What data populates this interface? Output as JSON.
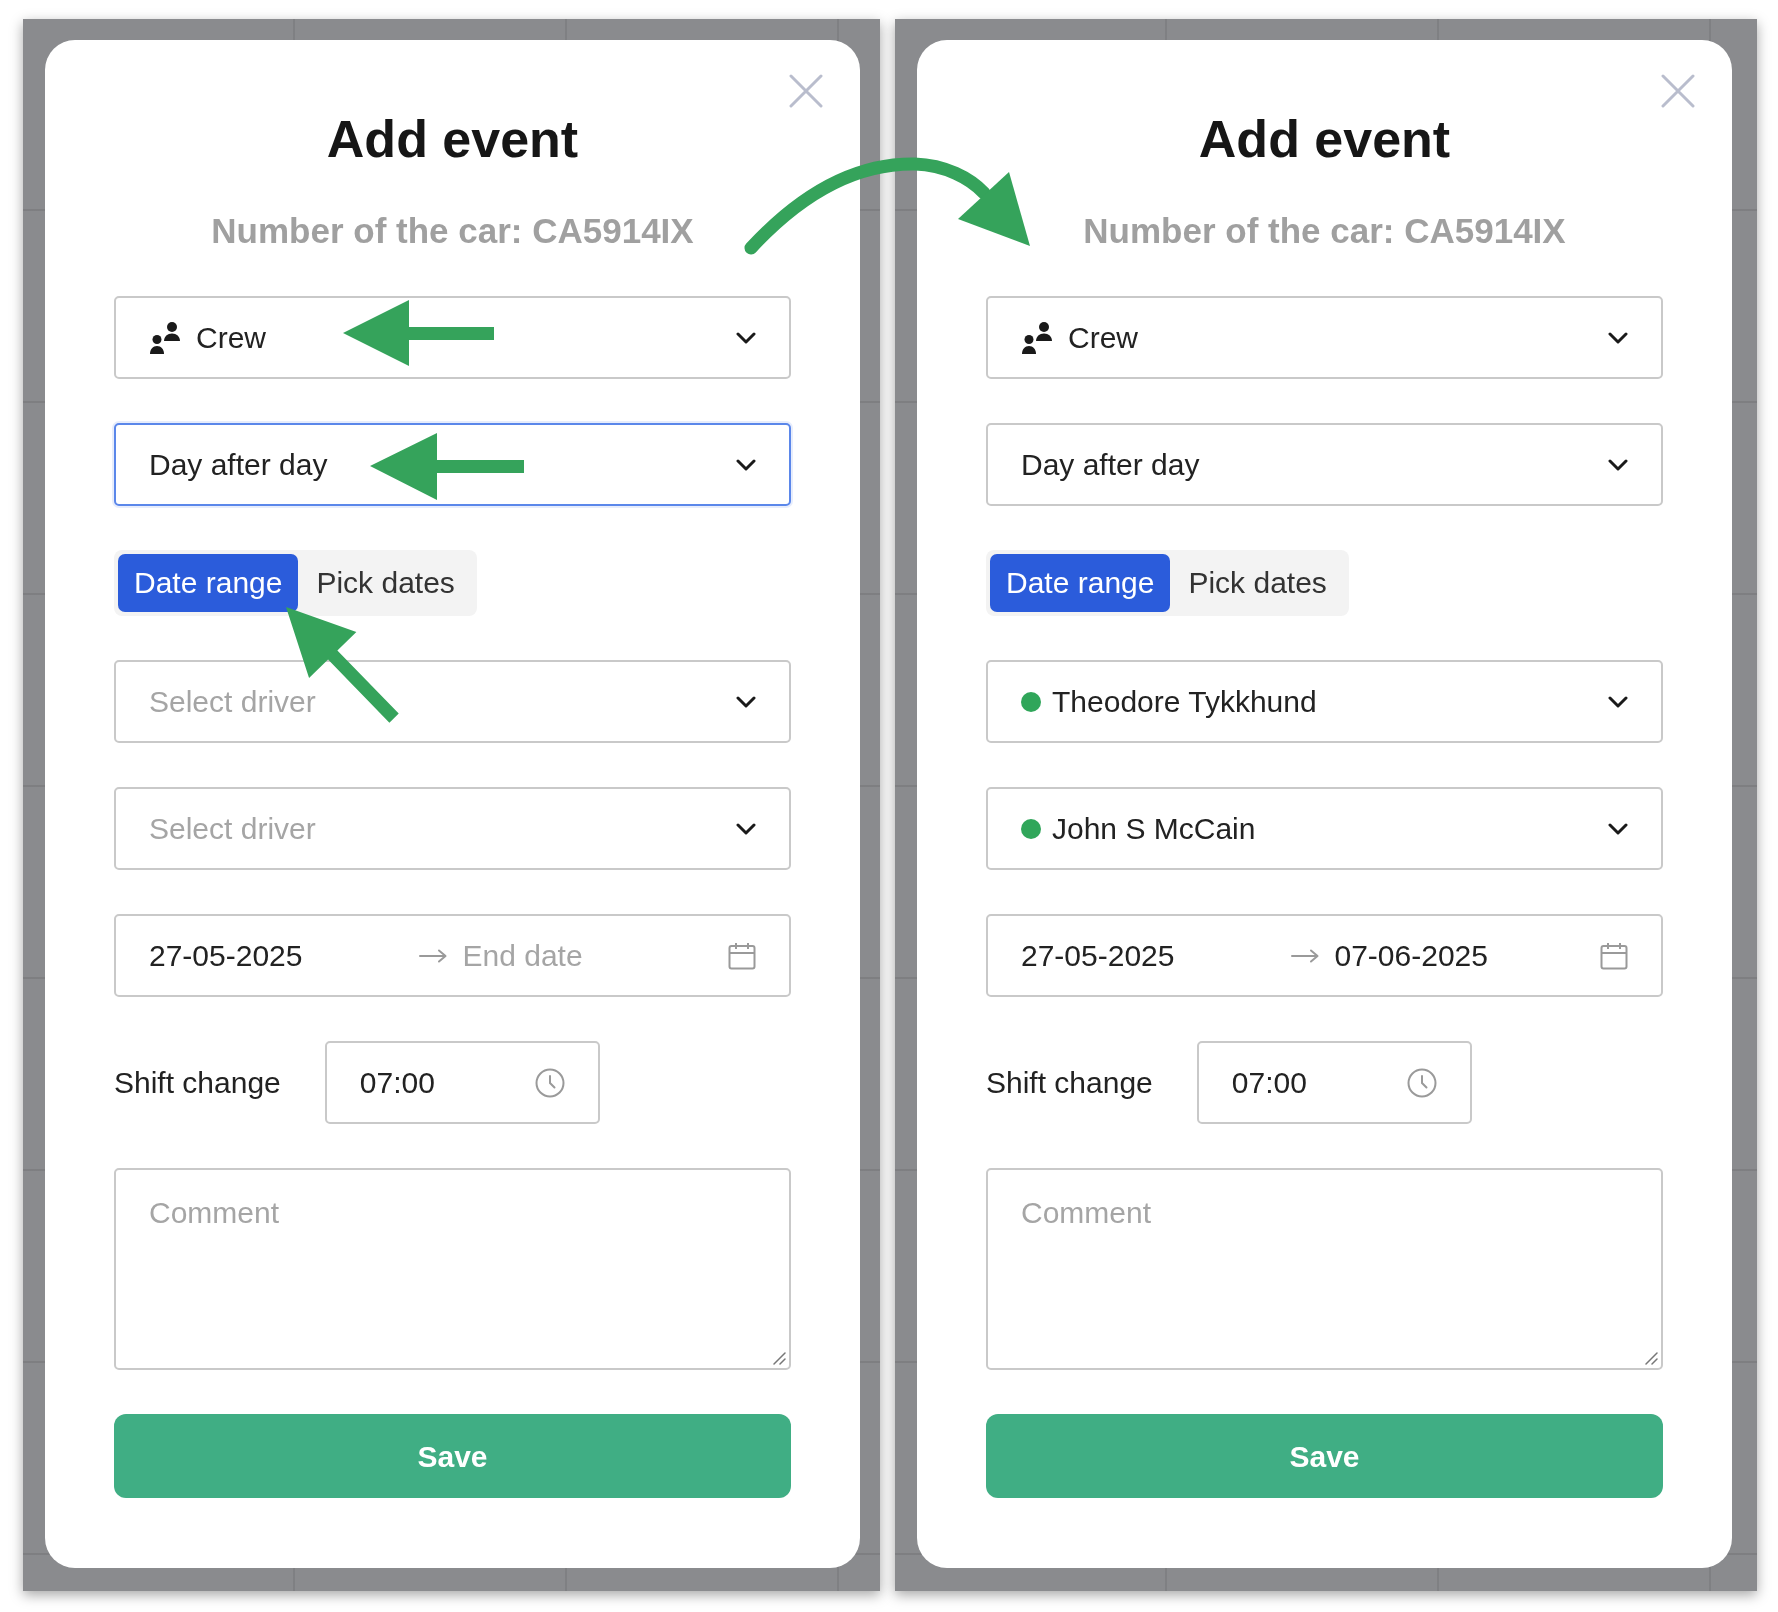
{
  "panels": [
    {
      "title": "Add event",
      "subtitle": "Number of the car: CA5914IX",
      "event_type": {
        "value": "Crew",
        "focused": false
      },
      "repeat": {
        "value": "Day after day",
        "focused": true
      },
      "date_mode_tabs": [
        {
          "label": "Date range",
          "selected": true
        },
        {
          "label": "Pick dates",
          "selected": false
        }
      ],
      "drivers": [
        {
          "placeholder": "Select driver"
        },
        {
          "placeholder": "Select driver"
        }
      ],
      "date_range": {
        "start": {
          "value": "27-05-2025"
        },
        "end": {
          "placeholder": "End date"
        }
      },
      "shift_change": {
        "label": "Shift change",
        "value": "07:00"
      },
      "comment": {
        "placeholder": "Comment"
      },
      "save_button": "Save"
    },
    {
      "title": "Add event",
      "subtitle": "Number of the car: CA5914IX",
      "event_type": {
        "value": "Crew",
        "focused": false
      },
      "repeat": {
        "value": "Day after day",
        "focused": false
      },
      "date_mode_tabs": [
        {
          "label": "Date range",
          "selected": true
        },
        {
          "label": "Pick dates",
          "selected": false
        }
      ],
      "drivers": [
        {
          "value": "Theodore Tykkhund",
          "color": "#30a65a"
        },
        {
          "value": "John S McCain",
          "color": "#30a65a"
        }
      ],
      "date_range": {
        "start": {
          "value": "27-05-2025"
        },
        "end": {
          "value": "07-06-2025"
        }
      },
      "shift_change": {
        "label": "Shift change",
        "value": "07:00"
      },
      "comment": {
        "placeholder": "Comment"
      },
      "save_button": "Save"
    }
  ]
}
